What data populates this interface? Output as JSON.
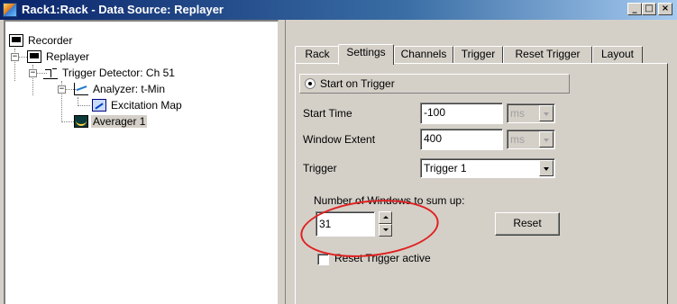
{
  "window": {
    "title": "Rack1:Rack - Data Source: Replayer",
    "controls": {
      "minimize": "_",
      "maximize": "□",
      "close": "×"
    }
  },
  "tree": {
    "nodes": [
      {
        "label": "Recorder",
        "icon": "monitor-icon"
      },
      {
        "label": "Replayer",
        "icon": "monitor-icon"
      },
      {
        "label": "Trigger Detector: Ch 51",
        "icon": "trigger-icon"
      },
      {
        "label": "Analyzer: t-Min",
        "icon": "analyzer-icon"
      },
      {
        "label": "Excitation Map",
        "icon": "excitation-map-icon"
      },
      {
        "label": "Averager 1",
        "icon": "averager-icon",
        "selected": true
      }
    ],
    "expanders": {
      "replayer": "−",
      "trigger_detector": "−",
      "analyzer": "−"
    }
  },
  "tabs": [
    "Rack",
    "Settings",
    "Channels",
    "Trigger",
    "Reset Trigger",
    "Layout"
  ],
  "active_tab": "Settings",
  "settings": {
    "start_on_trigger": {
      "label": "Start on Trigger",
      "checked": true
    },
    "start_time": {
      "label": "Start Time",
      "value": "-100",
      "unit": "ms"
    },
    "window_extent": {
      "label": "Window Extent",
      "value": "400",
      "unit": "ms"
    },
    "trigger": {
      "label": "Trigger",
      "value": "Trigger 1"
    },
    "windows_to_sum": {
      "label": "Number of Windows to sum up:",
      "value": "31"
    },
    "reset_button": "Reset",
    "reset_trigger_active": {
      "label": "Reset Trigger active",
      "checked": false
    }
  },
  "colors": {
    "titlebar_start": "#0a246a",
    "titlebar_end": "#a6caf0",
    "face": "#d4d0c8",
    "annotation": "#e02020"
  }
}
